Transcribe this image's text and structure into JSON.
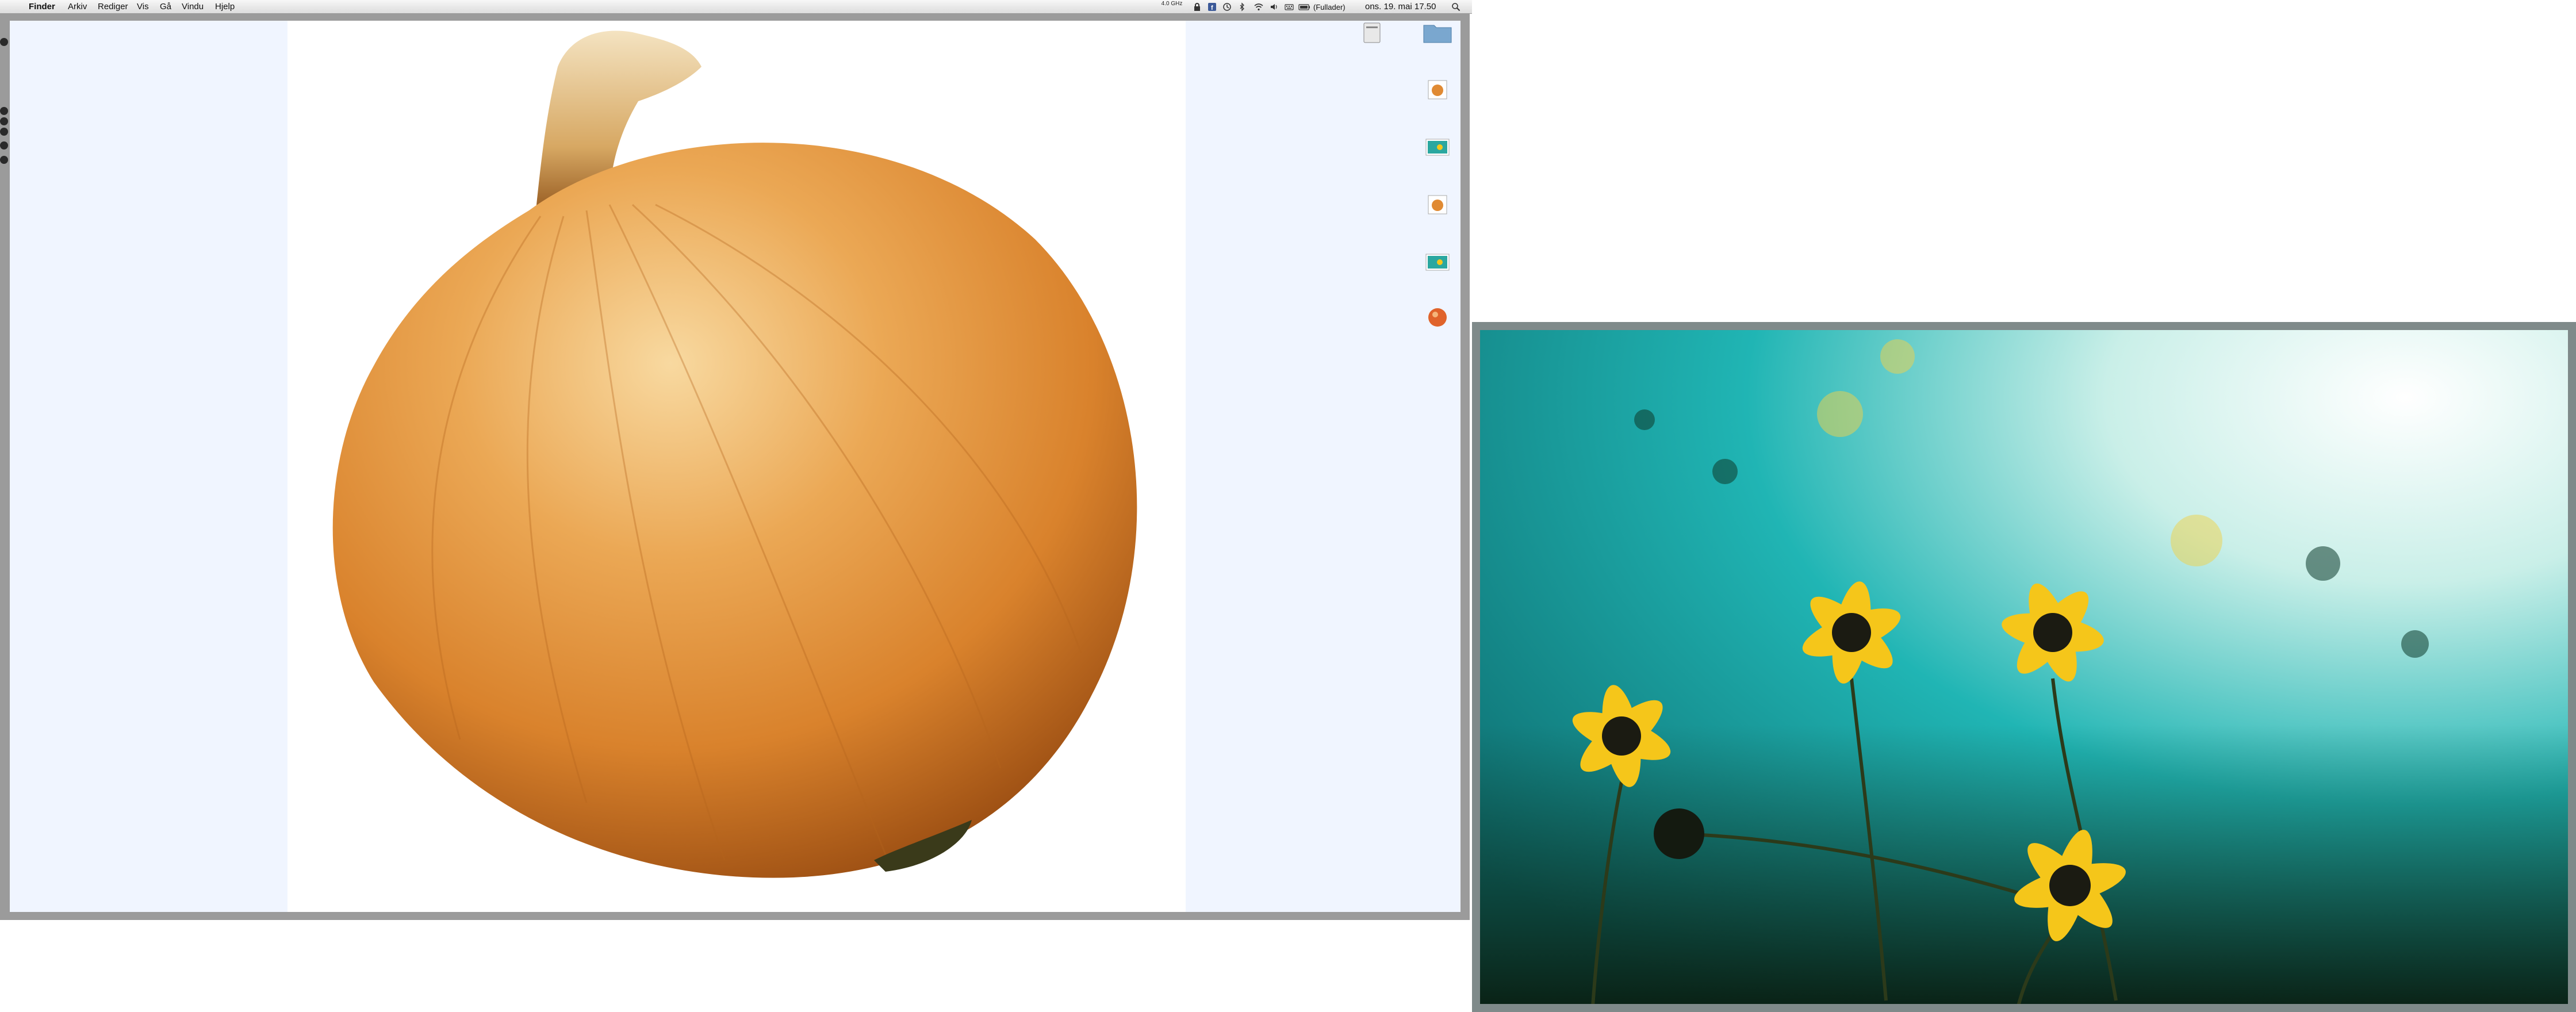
{
  "menubar": {
    "apple_glyph": "",
    "items": [
      "Finder",
      "Arkiv",
      "Rediger",
      "Vis",
      "Gå",
      "Vindu",
      "Hjelp"
    ],
    "status_small_text": "4.0 GHz",
    "battery_text": "(Fullader)",
    "clock": "ons. 19. mai 17.50",
    "status_icons": [
      "lock-icon",
      "facebook-icon",
      "time-machine-icon",
      "bluetooth-icon",
      "wifi-icon",
      "volume-icon",
      "keyboard-icon",
      "battery-icon",
      "spotlight-icon"
    ]
  },
  "window": {
    "photo": "onion",
    "colors": {
      "frame": "#9b9b9b",
      "side_panel": "#f0f5ff"
    }
  },
  "desktop_icons": [
    {
      "name": "disk-icon",
      "label": ""
    },
    {
      "name": "folder-icon",
      "label": ""
    },
    {
      "name": "image-file-icon",
      "label": ""
    },
    {
      "name": "image-file-icon",
      "label": ""
    },
    {
      "name": "image-file-icon",
      "label": ""
    },
    {
      "name": "image-file-icon",
      "label": ""
    },
    {
      "name": "image-file-icon",
      "label": ""
    }
  ],
  "background_photo": {
    "subject": "yellow flowers against teal sky",
    "colors": {
      "sky": "#18b1b4",
      "petal": "#f5c61a",
      "center": "#1b1b12"
    }
  }
}
